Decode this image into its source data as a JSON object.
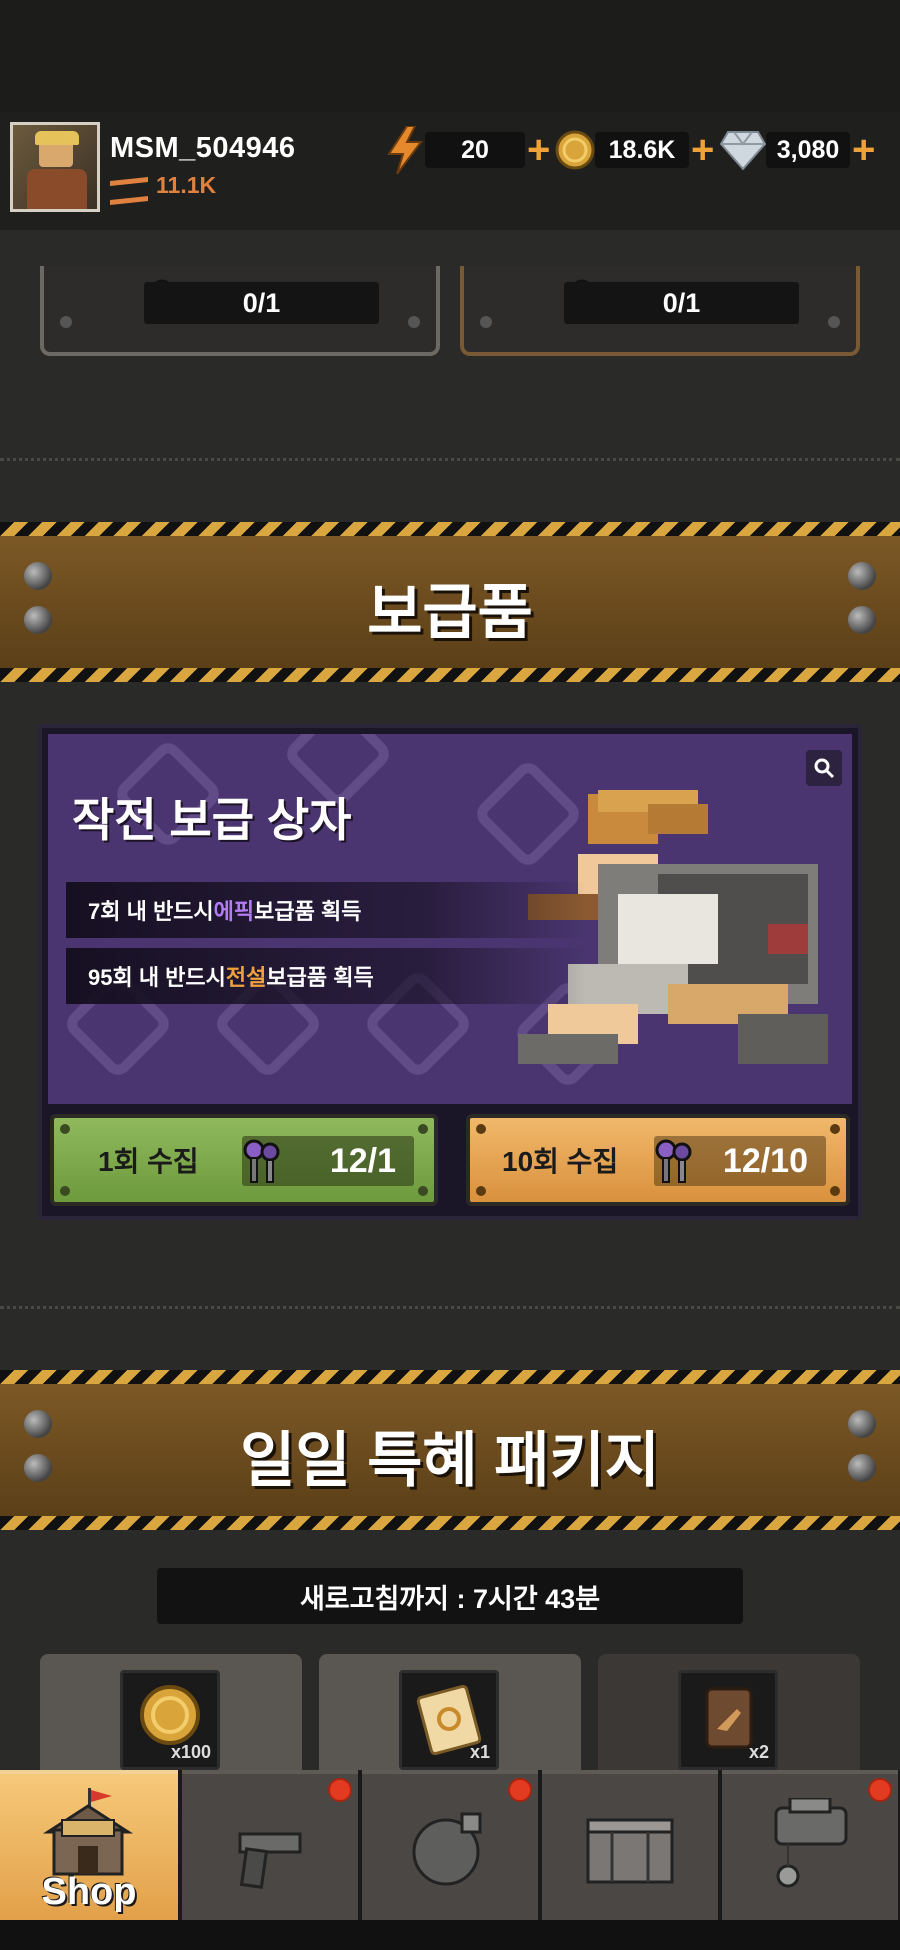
{
  "player": {
    "name": "MSM_504946",
    "rank": "11.1K"
  },
  "resources": [
    {
      "icon": "energy-bolt-icon",
      "value": "20"
    },
    {
      "icon": "gold-coin-icon",
      "value": "18.6K"
    },
    {
      "icon": "diamond-icon",
      "value": "3,080"
    }
  ],
  "top_panels": [
    {
      "count": "0/1"
    },
    {
      "count": "0/1"
    }
  ],
  "supply_section": {
    "banner_title": "보급품",
    "box_title": "작전 보급 상자",
    "line1_prefix": "7회 내 반드시 ",
    "line1_highlight": "에픽",
    "line1_suffix": " 보급품 획득",
    "line2_prefix": "95회 내 반드시 ",
    "line2_highlight": "전설",
    "line2_suffix": " 보급품 획득",
    "buttons": [
      {
        "label": "1회 수집",
        "cost": "12/1"
      },
      {
        "label": "10회 수집",
        "cost": "12/10"
      }
    ]
  },
  "daily_section": {
    "banner_title": "일일 특혜 패키지",
    "timer": "새로고침까지 : 7시간 43분",
    "cards": [
      {
        "icon": "gold-coin-icon",
        "qty": "x100"
      },
      {
        "icon": "ticket-icon",
        "qty": "x1"
      },
      {
        "icon": "weapon-card-icon",
        "qty": "x2"
      }
    ]
  },
  "tabs": [
    {
      "name": "shop",
      "label": "Shop",
      "active": true
    },
    {
      "name": "weapon",
      "label": ""
    },
    {
      "name": "bomb",
      "label": ""
    },
    {
      "name": "crate",
      "label": ""
    },
    {
      "name": "vehicle",
      "label": ""
    }
  ],
  "colors": {
    "epic": "#b27cf5",
    "legend": "#f0a13c",
    "accent": "#f0a23a",
    "notify": "#e23b22"
  }
}
